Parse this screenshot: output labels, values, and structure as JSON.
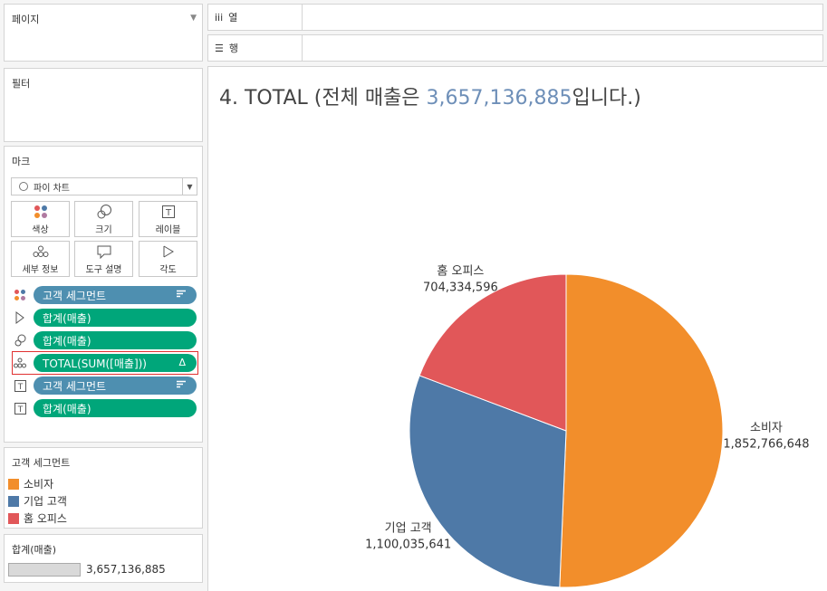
{
  "pages": {
    "label": "페이지"
  },
  "shelves": {
    "columns_label": "열",
    "rows_label": "행"
  },
  "filters": {
    "label": "필터"
  },
  "marks": {
    "label": "마크",
    "mark_type": "파이 차트",
    "buttons": [
      "색상",
      "크기",
      "레이블",
      "세부 정보",
      "도구 설명",
      "각도"
    ],
    "pills": [
      {
        "icon": "color-icon",
        "text": "고객 세그먼트",
        "color": "#4e8fb0",
        "type": "dimension",
        "marker": "sort"
      },
      {
        "icon": "angle-icon",
        "text": "합계(매출)",
        "color": "#00a67a",
        "type": "measure"
      },
      {
        "icon": "size-icon",
        "text": "합계(매출)",
        "color": "#00a67a",
        "type": "measure"
      },
      {
        "icon": "detail-icon",
        "text": "TOTAL(SUM([매출]))",
        "color": "#00a67a",
        "type": "measure",
        "marker": "Δ",
        "highlighted": true
      },
      {
        "icon": "label-icon",
        "text": "고객 세그먼트",
        "color": "#4e8fb0",
        "type": "dimension",
        "marker": "sort"
      },
      {
        "icon": "label-icon",
        "text": "합계(매출)",
        "color": "#00a67a",
        "type": "measure"
      }
    ]
  },
  "legend": {
    "title": "고객 세그먼트",
    "items": [
      {
        "label": "소비자",
        "color": "#f28e2b"
      },
      {
        "label": "기업 고객",
        "color": "#4e79a7"
      },
      {
        "label": "홈 오피스",
        "color": "#e15759"
      }
    ]
  },
  "size_legend": {
    "title": "합계(매출)",
    "value": "3,657,136,885"
  },
  "view": {
    "title_prefix": "4. TOTAL (전체 매출은 ",
    "title_number": "3,657,136,885",
    "title_suffix": "입니다.)"
  },
  "chart_data": {
    "type": "pie",
    "title": "4. TOTAL (전체 매출은 3,657,136,885입니다.)",
    "slices": [
      {
        "label": "소비자",
        "value": 1852766648,
        "value_label": "1,852,766,648",
        "color": "#f28e2b"
      },
      {
        "label": "기업 고객",
        "value": 1100035641,
        "value_label": "1,100,035,641",
        "color": "#4e79a7"
      },
      {
        "label": "홈 오피스",
        "value": 704334596,
        "value_label": "704,334,596",
        "color": "#e15759"
      }
    ],
    "total": 3657136885
  }
}
